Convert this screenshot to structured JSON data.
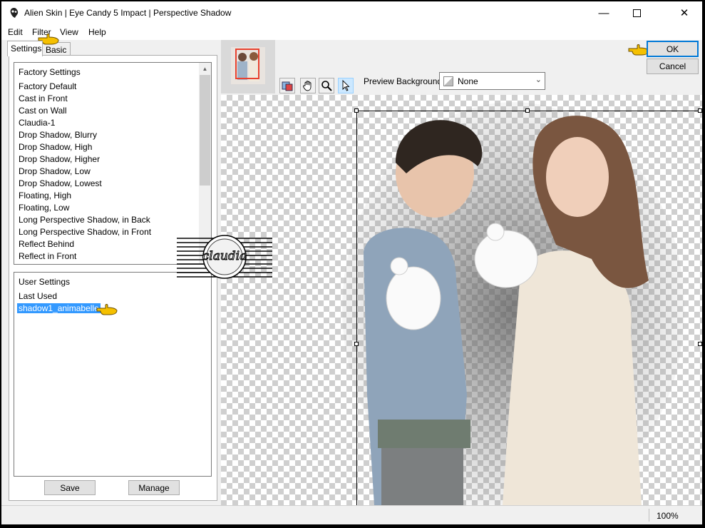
{
  "window": {
    "title": "Alien Skin | Eye Candy 5 Impact | Perspective Shadow",
    "minimize_icon": "minimize-icon",
    "maximize_icon": "maximize-icon",
    "close_icon": "close-icon"
  },
  "menu": [
    "Edit",
    "Filter",
    "View",
    "Help"
  ],
  "tabs": [
    {
      "label": "Settings",
      "active": true
    },
    {
      "label": "Basic",
      "active": false
    }
  ],
  "factory_settings": {
    "header": "Factory Settings",
    "items": [
      "Factory Default",
      "Cast in Front",
      "Cast on Wall",
      "Claudia-1",
      "Drop Shadow, Blurry",
      "Drop Shadow, High",
      "Drop Shadow, Higher",
      "Drop Shadow, Low",
      "Drop Shadow, Lowest",
      "Floating, High",
      "Floating, Low",
      "Long Perspective Shadow, in Back",
      "Long Perspective Shadow, in Front",
      "Reflect Behind",
      "Reflect in Front"
    ]
  },
  "user_settings": {
    "header": "User Settings",
    "items": [
      "Last Used",
      "shadow1_animabelle"
    ],
    "selected": "shadow1_animabelle"
  },
  "buttons": {
    "save": "Save",
    "manage": "Manage",
    "ok": "OK",
    "cancel": "Cancel"
  },
  "preview_background": {
    "label": "Preview Background:",
    "value": "None"
  },
  "tools": [
    "preview-image-icon",
    "hand-tool-icon",
    "zoom-tool-icon",
    "select-arrow-icon"
  ],
  "status": {
    "zoom": "100%"
  },
  "watermark": {
    "text": "claudia"
  },
  "colors": {
    "selection": "#3399ff",
    "pointer_hand": "#f5c000",
    "ok_border": "#0078d7"
  }
}
